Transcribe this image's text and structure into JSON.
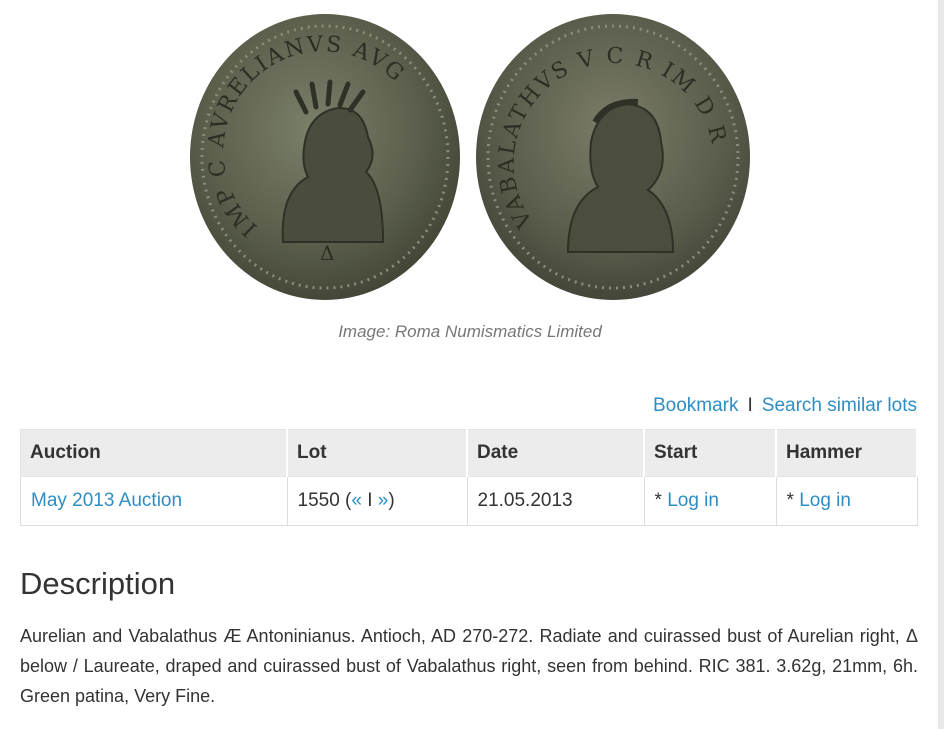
{
  "image": {
    "caption": "Image: Roma Numismatics Limited",
    "obverse_legend": "IMP C AVRELIANVS AVG",
    "reverse_legend": "VABALATHVS V C R IM D R",
    "obverse_mark": "Δ"
  },
  "actions": {
    "bookmark": "Bookmark",
    "separator": "I",
    "search_similar": "Search similar lots"
  },
  "table": {
    "headers": [
      "Auction",
      "Lot",
      "Date",
      "Start",
      "Hammer"
    ],
    "row": {
      "auction": "May 2013 Auction",
      "lot_number": "1550 (",
      "lot_prev": "«",
      "lot_sep": " I ",
      "lot_next": "»",
      "lot_close": ")",
      "date": "21.05.2013",
      "start_prefix": "* ",
      "start_link": "Log in",
      "hammer_prefix": "* ",
      "hammer_link": "Log in"
    }
  },
  "description": {
    "title": "Description",
    "text": "Aurelian and Vabalathus Æ Antoninianus. Antioch, AD 270-272. Radiate and cuirassed bust of Aurelian right, Δ below / Laureate, draped and cuirassed bust of Vabalathus right, seen from behind. RIC 381. 3.62g, 21mm, 6h. Green patina, Very Fine."
  }
}
